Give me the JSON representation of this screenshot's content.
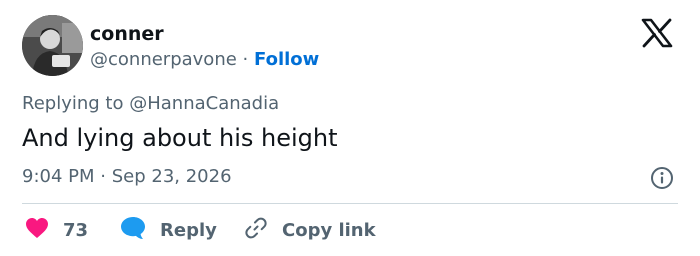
{
  "author": {
    "name": "conner",
    "handle": "@connerpavone",
    "separator": "·",
    "follow_label": "Follow"
  },
  "reply": {
    "prefix": "Replying to",
    "mention": "@HannaCanadia"
  },
  "tweet": {
    "text": "And lying about his height",
    "time": "9:04 PM",
    "separator": "·",
    "date": "Sep 23, 2026"
  },
  "actions": {
    "like_count": "73",
    "reply_label": "Reply",
    "copy_label": "Copy link"
  },
  "colors": {
    "accent": "#006fd6",
    "like": "#f91880",
    "reply_bubble": "#1d9bf0",
    "muted": "#536471",
    "divider": "#cfd9de"
  },
  "icons": {
    "brand": "x-logo-icon",
    "info": "info-icon",
    "like": "heart-icon",
    "reply": "speech-bubble-icon",
    "copy": "link-icon"
  }
}
